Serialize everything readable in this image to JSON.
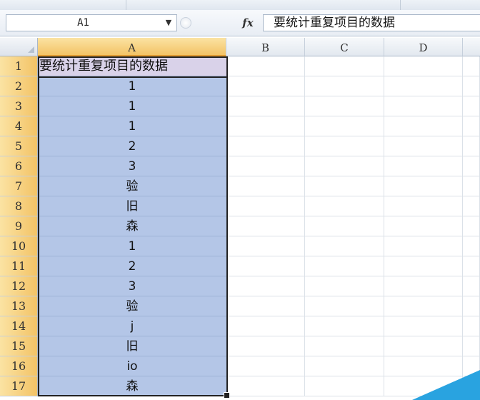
{
  "name_box": {
    "value": "A1"
  },
  "formula_bar": {
    "fx_label": "fx",
    "content": "要统计重复项目的数据"
  },
  "columns": [
    {
      "label": "A"
    },
    {
      "label": "B"
    },
    {
      "label": "C"
    },
    {
      "label": "D"
    }
  ],
  "rows": [
    "1",
    "2",
    "3",
    "4",
    "5",
    "6",
    "7",
    "8",
    "9",
    "10",
    "11",
    "12",
    "13",
    "14",
    "15",
    "16",
    "17"
  ],
  "column_a": [
    "要统计重复项目的数据",
    "1",
    "1",
    "1",
    "2",
    "3",
    "验",
    "旧",
    "森",
    "1",
    "2",
    "3",
    "验",
    "j",
    "旧",
    "io",
    "森"
  ],
  "selection": {
    "active_cell": "A1",
    "range": "A1:A17"
  },
  "colors": {
    "selected_fill": "#b4c6e7",
    "active_fill": "#d9d2e9",
    "header_highlight": "#f3c366",
    "accent": "#29a3e0"
  }
}
